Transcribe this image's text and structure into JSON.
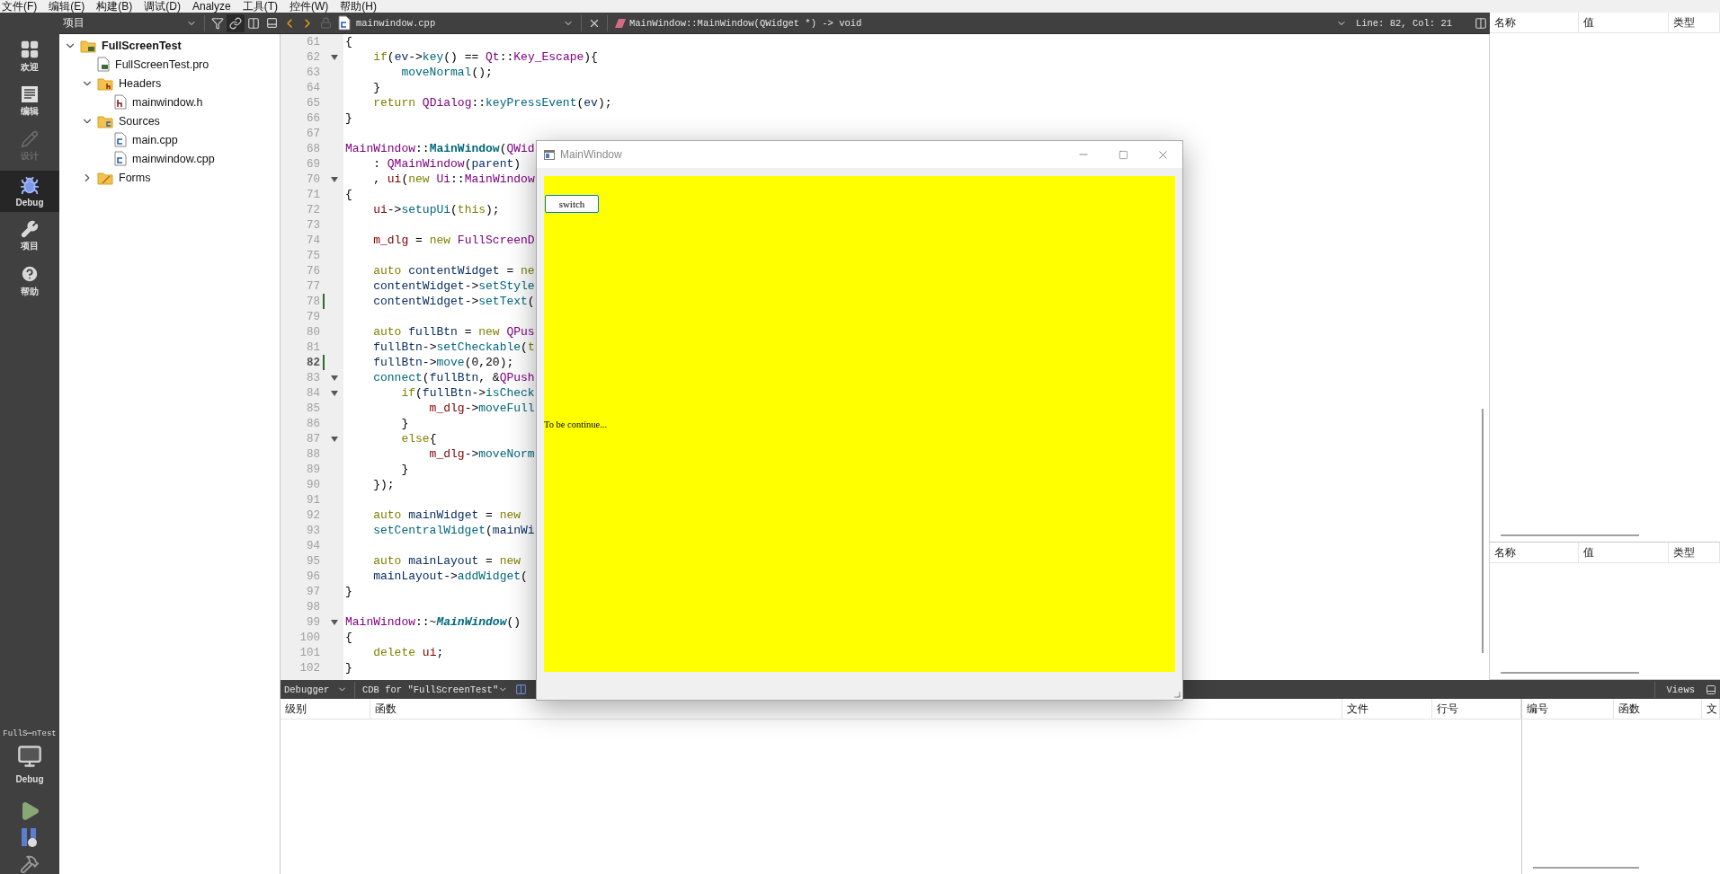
{
  "menu_bar": [
    "文件(F)",
    "编辑(E)",
    "构建(B)",
    "调试(D)",
    "Analyze",
    "工具(T)",
    "控件(W)",
    "帮助(H)"
  ],
  "mode_bar": {
    "modes": [
      {
        "kind": "welcome",
        "label": "欢迎",
        "selected": false,
        "disabled": false
      },
      {
        "kind": "edit",
        "label": "编辑",
        "selected": false,
        "disabled": false
      },
      {
        "kind": "design",
        "label": "设计",
        "selected": false,
        "disabled": true
      },
      {
        "kind": "debug",
        "label": "Debug",
        "selected": true,
        "disabled": false
      },
      {
        "kind": "projects",
        "label": "项目",
        "selected": false,
        "disabled": false
      },
      {
        "kind": "help",
        "label": "帮助",
        "selected": false,
        "disabled": false
      }
    ],
    "kit": {
      "project": "FullS⋯nTest",
      "config": "Debug"
    }
  },
  "project_panel": {
    "title": "项目",
    "tree": [
      {
        "kind": "project",
        "label": "FullScreenTest",
        "expanded": true,
        "children": [
          {
            "kind": "pro-file",
            "label": "FullScreenTest.pro"
          },
          {
            "kind": "header-folder",
            "label": "Headers",
            "expanded": true,
            "children": [
              {
                "kind": "header-file",
                "label": "mainwindow.h"
              }
            ]
          },
          {
            "kind": "source-folder",
            "label": "Sources",
            "expanded": true,
            "children": [
              {
                "kind": "source-file",
                "label": "main.cpp"
              },
              {
                "kind": "source-file",
                "label": "mainwindow.cpp"
              }
            ]
          },
          {
            "kind": "forms-folder",
            "label": "Forms",
            "expanded": false
          }
        ]
      }
    ]
  },
  "editor": {
    "file": "mainwindow.cpp",
    "symbol": "MainWindow::MainWindow(QWidget *) -> void",
    "position": "Line: 82, Col: 21",
    "lines": [
      {
        "number": "61",
        "fold": false,
        "changed": false,
        "current": false,
        "tokens": [
          {
            "kind": "plain",
            "text": "{"
          }
        ]
      },
      {
        "number": "62",
        "fold": true,
        "changed": false,
        "current": false,
        "tokens": [
          {
            "kind": "keyword",
            "text": "    if"
          },
          {
            "kind": "plain",
            "text": "("
          },
          {
            "kind": "local",
            "text": "ev"
          },
          {
            "kind": "plain",
            "text": "->"
          },
          {
            "kind": "function",
            "text": "key"
          },
          {
            "kind": "plain",
            "text": "() == "
          },
          {
            "kind": "type",
            "text": "Qt"
          },
          {
            "kind": "plain",
            "text": "::"
          },
          {
            "kind": "type",
            "text": "Key_Escape"
          },
          {
            "kind": "plain",
            "text": "){"
          }
        ]
      },
      {
        "number": "63",
        "fold": false,
        "changed": false,
        "current": false,
        "tokens": [
          {
            "kind": "function",
            "text": "        moveNormal"
          },
          {
            "kind": "plain",
            "text": "();"
          }
        ]
      },
      {
        "number": "64",
        "fold": false,
        "changed": false,
        "current": false,
        "tokens": [
          {
            "kind": "plain",
            "text": "    }"
          }
        ]
      },
      {
        "number": "65",
        "fold": false,
        "changed": false,
        "current": false,
        "tokens": [
          {
            "kind": "keyword",
            "text": "    return "
          },
          {
            "kind": "type",
            "text": "QDialog"
          },
          {
            "kind": "plain",
            "text": "::"
          },
          {
            "kind": "function",
            "text": "keyPressEvent"
          },
          {
            "kind": "plain",
            "text": "("
          },
          {
            "kind": "local",
            "text": "ev"
          },
          {
            "kind": "plain",
            "text": ");"
          }
        ]
      },
      {
        "number": "66",
        "fold": false,
        "changed": false,
        "current": false,
        "tokens": [
          {
            "kind": "plain",
            "text": "}"
          }
        ]
      },
      {
        "number": "67",
        "fold": false,
        "changed": false,
        "current": false
      },
      {
        "number": "68",
        "fold": false,
        "changed": false,
        "current": false,
        "tokens": [
          {
            "kind": "type",
            "text": "MainWindow"
          },
          {
            "kind": "plain",
            "text": "::"
          },
          {
            "kind": "decl",
            "text": "MainWindow"
          },
          {
            "kind": "plain",
            "text": "("
          },
          {
            "kind": "type",
            "text": "QWid"
          }
        ]
      },
      {
        "number": "69",
        "fold": false,
        "changed": false,
        "current": false,
        "tokens": [
          {
            "kind": "plain",
            "text": "    : "
          },
          {
            "kind": "type",
            "text": "QMainWindow"
          },
          {
            "kind": "plain",
            "text": "("
          },
          {
            "kind": "local",
            "text": "parent"
          },
          {
            "kind": "plain",
            "text": ")"
          }
        ]
      },
      {
        "number": "70",
        "fold": true,
        "changed": false,
        "current": false,
        "tokens": [
          {
            "kind": "plain",
            "text": "    , "
          },
          {
            "kind": "member",
            "text": "ui"
          },
          {
            "kind": "plain",
            "text": "("
          },
          {
            "kind": "keyword",
            "text": "new "
          },
          {
            "kind": "type",
            "text": "Ui"
          },
          {
            "kind": "plain",
            "text": "::"
          },
          {
            "kind": "type",
            "text": "MainWindow"
          }
        ]
      },
      {
        "number": "71",
        "fold": false,
        "changed": false,
        "current": false,
        "tokens": [
          {
            "kind": "plain",
            "text": "{"
          }
        ]
      },
      {
        "number": "72",
        "fold": false,
        "changed": false,
        "current": false,
        "tokens": [
          {
            "kind": "member",
            "text": "    ui"
          },
          {
            "kind": "plain",
            "text": "->"
          },
          {
            "kind": "function",
            "text": "setupUi"
          },
          {
            "kind": "plain",
            "text": "("
          },
          {
            "kind": "keyword",
            "text": "this"
          },
          {
            "kind": "plain",
            "text": ");"
          }
        ]
      },
      {
        "number": "73",
        "fold": false,
        "changed": false,
        "current": false
      },
      {
        "number": "74",
        "fold": false,
        "changed": false,
        "current": false,
        "tokens": [
          {
            "kind": "member",
            "text": "    m_dlg"
          },
          {
            "kind": "plain",
            "text": " = "
          },
          {
            "kind": "keyword",
            "text": "new "
          },
          {
            "kind": "type",
            "text": "FullScreenD"
          }
        ]
      },
      {
        "number": "75",
        "fold": false,
        "changed": false,
        "current": false
      },
      {
        "number": "76",
        "fold": false,
        "changed": false,
        "current": false,
        "tokens": [
          {
            "kind": "keyword",
            "text": "    auto "
          },
          {
            "kind": "local",
            "text": "contentWidget"
          },
          {
            "kind": "plain",
            "text": " = "
          },
          {
            "kind": "keyword",
            "text": "ne"
          }
        ]
      },
      {
        "number": "77",
        "fold": false,
        "changed": false,
        "current": false,
        "tokens": [
          {
            "kind": "local",
            "text": "    contentWidget"
          },
          {
            "kind": "plain",
            "text": "->"
          },
          {
            "kind": "function",
            "text": "setStyle"
          }
        ]
      },
      {
        "number": "78",
        "fold": false,
        "changed": true,
        "current": false,
        "tokens": [
          {
            "kind": "local",
            "text": "    contentWidget"
          },
          {
            "kind": "plain",
            "text": "->"
          },
          {
            "kind": "function",
            "text": "setText"
          },
          {
            "kind": "plain",
            "text": "("
          }
        ]
      },
      {
        "number": "79",
        "fold": false,
        "changed": false,
        "current": false
      },
      {
        "number": "80",
        "fold": false,
        "changed": false,
        "current": false,
        "tokens": [
          {
            "kind": "keyword",
            "text": "    auto "
          },
          {
            "kind": "local",
            "text": "fullBtn"
          },
          {
            "kind": "plain",
            "text": " = "
          },
          {
            "kind": "keyword",
            "text": "new "
          },
          {
            "kind": "type",
            "text": "QPus"
          }
        ]
      },
      {
        "number": "81",
        "fold": false,
        "changed": false,
        "current": false,
        "tokens": [
          {
            "kind": "local",
            "text": "    fullBtn"
          },
          {
            "kind": "plain",
            "text": "->"
          },
          {
            "kind": "function",
            "text": "setCheckable"
          },
          {
            "kind": "plain",
            "text": "("
          },
          {
            "kind": "keyword",
            "text": "t"
          }
        ]
      },
      {
        "number": "82",
        "fold": false,
        "changed": true,
        "current": true,
        "tokens": [
          {
            "kind": "local",
            "text": "    fullBtn"
          },
          {
            "kind": "plain",
            "text": "->"
          },
          {
            "kind": "function",
            "text": "move"
          },
          {
            "kind": "plain",
            "text": "(0,20);"
          }
        ]
      },
      {
        "number": "83",
        "fold": true,
        "changed": false,
        "current": false,
        "tokens": [
          {
            "kind": "function",
            "text": "    connect"
          },
          {
            "kind": "plain",
            "text": "("
          },
          {
            "kind": "local",
            "text": "fullBtn"
          },
          {
            "kind": "plain",
            "text": ", &"
          },
          {
            "kind": "type",
            "text": "QPush"
          }
        ]
      },
      {
        "number": "84",
        "fold": true,
        "changed": false,
        "current": false,
        "tokens": [
          {
            "kind": "keyword",
            "text": "        if"
          },
          {
            "kind": "plain",
            "text": "("
          },
          {
            "kind": "local",
            "text": "fullBtn"
          },
          {
            "kind": "plain",
            "text": "->"
          },
          {
            "kind": "function",
            "text": "isCheck"
          }
        ]
      },
      {
        "number": "85",
        "fold": false,
        "changed": false,
        "current": false,
        "tokens": [
          {
            "kind": "member",
            "text": "            m_dlg"
          },
          {
            "kind": "plain",
            "text": "->"
          },
          {
            "kind": "function",
            "text": "moveFull"
          }
        ]
      },
      {
        "number": "86",
        "fold": false,
        "changed": false,
        "current": false,
        "tokens": [
          {
            "kind": "plain",
            "text": "        }"
          }
        ]
      },
      {
        "number": "87",
        "fold": true,
        "changed": false,
        "current": false,
        "tokens": [
          {
            "kind": "keyword",
            "text": "        else"
          },
          {
            "kind": "plain",
            "text": "{"
          }
        ]
      },
      {
        "number": "88",
        "fold": false,
        "changed": false,
        "current": false,
        "tokens": [
          {
            "kind": "member",
            "text": "            m_dlg"
          },
          {
            "kind": "plain",
            "text": "->"
          },
          {
            "kind": "function",
            "text": "moveNorm"
          }
        ]
      },
      {
        "number": "89",
        "fold": false,
        "changed": false,
        "current": false,
        "tokens": [
          {
            "kind": "plain",
            "text": "        }"
          }
        ]
      },
      {
        "number": "90",
        "fold": false,
        "changed": false,
        "current": false,
        "tokens": [
          {
            "kind": "plain",
            "text": "    });"
          }
        ]
      },
      {
        "number": "91",
        "fold": false,
        "changed": false,
        "current": false
      },
      {
        "number": "92",
        "fold": false,
        "changed": false,
        "current": false,
        "tokens": [
          {
            "kind": "keyword",
            "text": "    auto "
          },
          {
            "kind": "local",
            "text": "mainWidget"
          },
          {
            "kind": "plain",
            "text": " = "
          },
          {
            "kind": "keyword",
            "text": "new"
          }
        ]
      },
      {
        "number": "93",
        "fold": false,
        "changed": false,
        "current": false,
        "tokens": [
          {
            "kind": "function",
            "text": "    setCentralWidget"
          },
          {
            "kind": "plain",
            "text": "("
          },
          {
            "kind": "local",
            "text": "mainWi"
          }
        ]
      },
      {
        "number": "94",
        "fold": false,
        "changed": false,
        "current": false
      },
      {
        "number": "95",
        "fold": false,
        "changed": false,
        "current": false,
        "tokens": [
          {
            "kind": "keyword",
            "text": "    auto "
          },
          {
            "kind": "local",
            "text": "mainLayout"
          },
          {
            "kind": "plain",
            "text": " = "
          },
          {
            "kind": "keyword",
            "text": "new"
          }
        ]
      },
      {
        "number": "96",
        "fold": false,
        "changed": false,
        "current": false,
        "tokens": [
          {
            "kind": "local",
            "text": "    mainLayout"
          },
          {
            "kind": "plain",
            "text": "->"
          },
          {
            "kind": "function",
            "text": "addWidget"
          },
          {
            "kind": "plain",
            "text": "("
          }
        ]
      },
      {
        "number": "97",
        "fold": false,
        "changed": false,
        "current": false,
        "tokens": [
          {
            "kind": "plain",
            "text": "}"
          }
        ]
      },
      {
        "number": "98",
        "fold": false,
        "changed": false,
        "current": false
      },
      {
        "number": "99",
        "fold": true,
        "changed": false,
        "current": false,
        "tokens": [
          {
            "kind": "type",
            "text": "MainWindow"
          },
          {
            "kind": "plain",
            "text": "::~"
          },
          {
            "kind": "italic",
            "text": "MainWindow"
          },
          {
            "kind": "plain",
            "text": "()"
          }
        ]
      },
      {
        "number": "100",
        "fold": false,
        "changed": false,
        "current": false,
        "tokens": [
          {
            "kind": "plain",
            "text": "{"
          }
        ]
      },
      {
        "number": "101",
        "fold": false,
        "changed": false,
        "current": false,
        "tokens": [
          {
            "kind": "keyword",
            "text": "    delete "
          },
          {
            "kind": "member",
            "text": "ui"
          },
          {
            "kind": "plain",
            "text": ";"
          }
        ]
      },
      {
        "number": "102",
        "fold": false,
        "changed": false,
        "current": false,
        "tokens": [
          {
            "kind": "plain",
            "text": "}"
          }
        ]
      }
    ]
  },
  "locals_panels": [
    {
      "columns": [
        "名称",
        "值",
        "类型"
      ]
    },
    {
      "columns": [
        "名称",
        "值",
        "类型"
      ]
    }
  ],
  "debugger_bar": {
    "engine": "Debugger",
    "kit": "CDB for \"FullScreenTest\"",
    "views": "Views"
  },
  "stack_panel": {
    "columns": [
      "级别",
      "函数",
      "文件",
      "行号"
    ]
  },
  "threads_panel": {
    "columns": [
      "编号",
      "函数",
      "文"
    ]
  },
  "app_window": {
    "title": "MainWindow",
    "button": "switch",
    "content": "To be continue..."
  }
}
